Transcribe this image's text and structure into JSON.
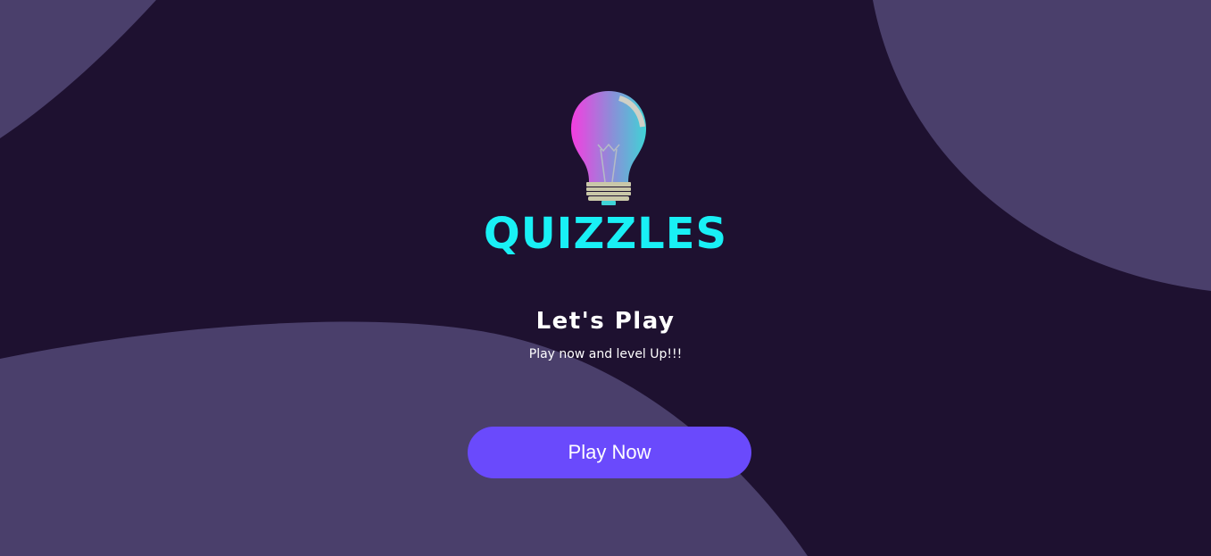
{
  "app": {
    "brand_name": "QUIZZLES",
    "logo_icon": "lightbulb-icon"
  },
  "hero": {
    "heading": "Let's Play",
    "subheading": "Play now and level Up!!!",
    "cta_label": "Play Now"
  },
  "colors": {
    "background": "#1e1130",
    "blob": "#4a3f6b",
    "brand": "#19f0f5",
    "button": "#6a4afc",
    "text": "#ffffff"
  }
}
